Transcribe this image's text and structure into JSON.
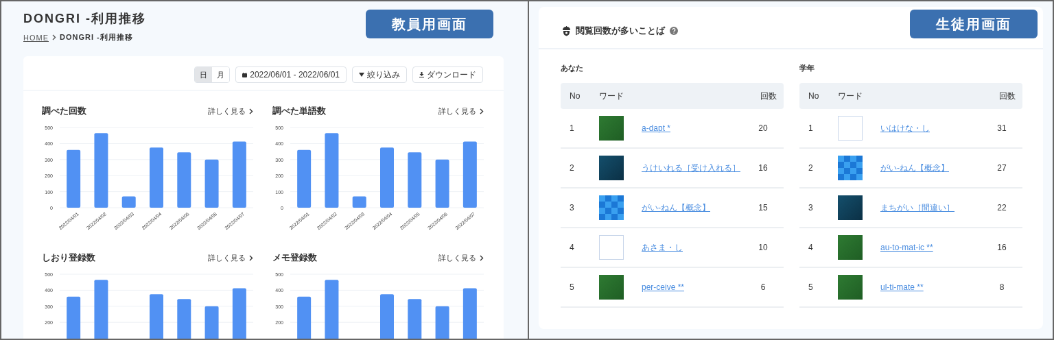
{
  "teacher_view": {
    "badge": "教員用画面",
    "title": "DONGRI -利用推移",
    "breadcrumb": [
      {
        "label": "HOME",
        "kind": "link"
      },
      {
        "label": "DONGRI -利用推移",
        "kind": "current"
      }
    ],
    "toolbar": {
      "period_tabs": [
        {
          "label": "日",
          "selected": true
        },
        {
          "label": "月",
          "selected": false
        }
      ],
      "date_range": "2022/06/01 - 2022/06/01",
      "filter_button": "絞り込み",
      "download_button": "ダウンロード"
    },
    "charts": [
      {
        "title": "調べた回数",
        "more_link": "詳しく見る",
        "chart_data": {
          "type": "bar",
          "categories": [
            "2022/04/01",
            "2022/04/02",
            "2022/04/03",
            "2022/04/04",
            "2022/04/05",
            "2022/04/06",
            "2022/04/07"
          ],
          "series": [
            {
              "color": "#5191f3",
              "values": [
                360,
                465,
                70,
                375,
                345,
                300,
                412
              ]
            }
          ],
          "ylim": [
            0,
            500
          ],
          "yticks": [
            0,
            100,
            200,
            300,
            400,
            500
          ],
          "grid": true
        }
      },
      {
        "title": "調べた単語数",
        "more_link": "詳しく見る",
        "chart_data": {
          "type": "bar",
          "categories": [
            "2022/04/01",
            "2022/04/02",
            "2022/04/03",
            "2022/04/04",
            "2022/04/05",
            "2022/04/06",
            "2022/04/07"
          ],
          "series": [
            {
              "color": "#5191f3",
              "values": [
                360,
                465,
                70,
                375,
                345,
                300,
                412
              ]
            }
          ],
          "ylim": [
            0,
            500
          ],
          "yticks": [
            0,
            100,
            200,
            300,
            400,
            500
          ],
          "grid": true
        }
      },
      {
        "title": "しおり登録数",
        "more_link": "詳しく見る",
        "chart_data": {
          "type": "bar",
          "series": [
            {
              "color": "#5191f3",
              "values": [
                360,
                465,
                null,
                375,
                345,
                300,
                412
              ]
            }
          ],
          "ylim": [
            0,
            500
          ],
          "yticks": [
            200,
            300,
            400,
            500
          ],
          "grid": true
        }
      },
      {
        "title": "メモ登録数",
        "more_link": "詳しく見る",
        "chart_data": {
          "type": "bar",
          "series": [
            {
              "color": "#5191f3",
              "values": [
                360,
                465,
                null,
                375,
                345,
                300,
                412
              ]
            }
          ],
          "ylim": [
            0,
            500
          ],
          "yticks": [
            200,
            300,
            400,
            500
          ],
          "grid": true
        }
      }
    ]
  },
  "student_view": {
    "badge": "生徒用画面",
    "title": "閲覧回数が多いことば",
    "rankings": [
      {
        "heading": "あなた",
        "columns": [
          "No",
          "ワード",
          "回数"
        ],
        "rows": [
          {
            "no": "1",
            "kind": "green",
            "word": "a-dapt *",
            "count": "20"
          },
          {
            "no": "2",
            "kind": "navy",
            "word": "うけいれる［受け入れる］",
            "count": "16"
          },
          {
            "no": "3",
            "kind": "checkered",
            "word": "がい-ねん【概念】",
            "count": "15"
          },
          {
            "no": "4",
            "kind": "white",
            "word": "あさま・し",
            "count": "10"
          },
          {
            "no": "5",
            "kind": "green",
            "word": "per-ceive **",
            "count": "6"
          }
        ]
      },
      {
        "heading": "学年",
        "columns": [
          "No",
          "ワード",
          "回数"
        ],
        "rows": [
          {
            "no": "1",
            "kind": "white",
            "word": "いはけな・し",
            "count": "31"
          },
          {
            "no": "2",
            "kind": "checkered",
            "word": "がい-ねん【概念】",
            "count": "27"
          },
          {
            "no": "3",
            "kind": "navy",
            "word": "まちがい［間違い］",
            "count": "22"
          },
          {
            "no": "4",
            "kind": "green",
            "word": "au-to-mat-ic **",
            "count": "16"
          },
          {
            "no": "5",
            "kind": "green",
            "word": "ul-ti-mate **",
            "count": "8"
          }
        ]
      }
    ]
  }
}
